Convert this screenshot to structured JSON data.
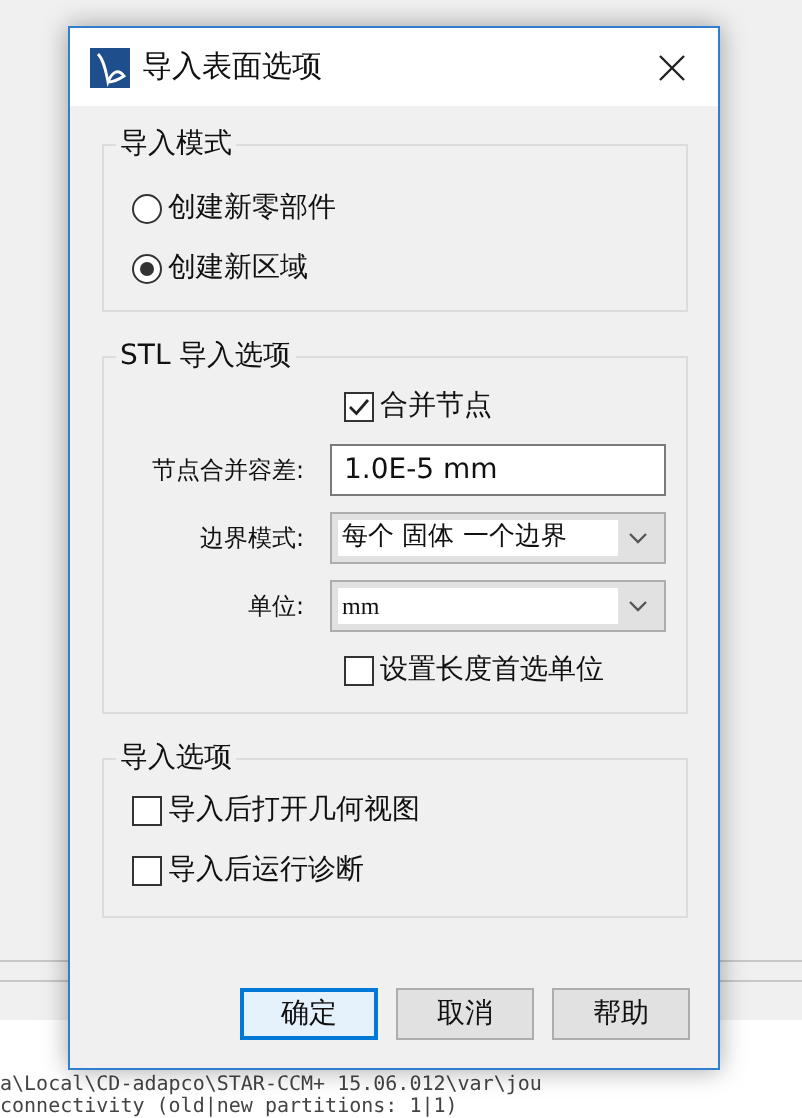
{
  "window": {
    "title": "导入表面选项"
  },
  "import_mode": {
    "title": "导入模式",
    "options": [
      {
        "label": "创建新零部件",
        "selected": false
      },
      {
        "label": "创建新区域",
        "selected": true
      }
    ]
  },
  "stl_options": {
    "title": "STL 导入选项",
    "merge_nodes": {
      "label": "合并节点",
      "checked": true
    },
    "tolerance": {
      "label": "节点合并容差:",
      "value": "1.0E-5 mm"
    },
    "boundary_mode": {
      "label": "边界模式:",
      "value": "每个 固体 一个边界"
    },
    "units": {
      "label": "单位:",
      "value": "mm"
    },
    "preferred_units": {
      "label": "设置长度首选单位",
      "checked": false
    }
  },
  "import_options": {
    "title": "导入选项",
    "items": [
      {
        "label": "导入后打开几何视图",
        "checked": false
      },
      {
        "label": "导入后运行诊断",
        "checked": false
      }
    ]
  },
  "buttons": [
    {
      "label": "确定",
      "default": true
    },
    {
      "label": "取消",
      "default": false
    },
    {
      "label": "帮助",
      "default": false
    }
  ],
  "console": [
    "a\\Local\\CD-adapco\\STAR-CCM+ 15.06.012\\var\\jou",
    "connectivity (old|new partitions: 1|1)"
  ]
}
